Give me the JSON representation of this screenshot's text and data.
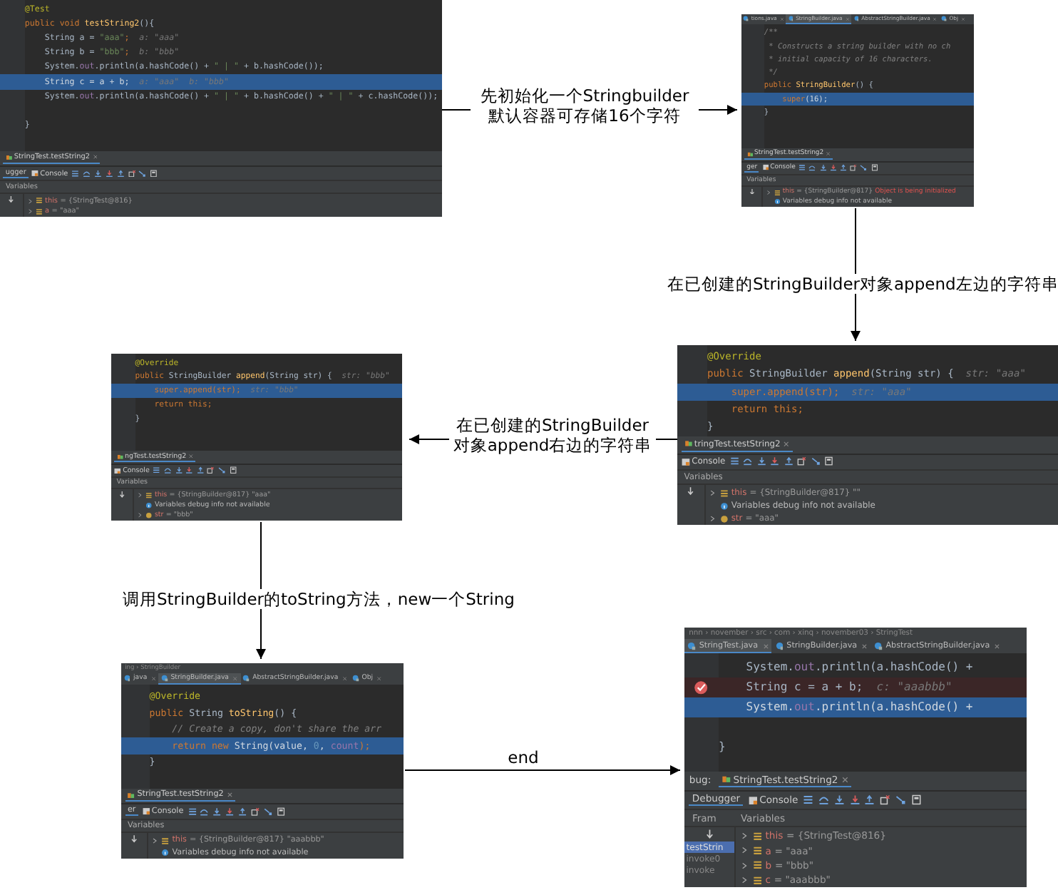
{
  "panels": [
    {
      "code": [
        {
          "highlight": false,
          "breakpoint": false,
          "segments": [
            {
              "text": "@Test",
              "kind": "ann"
            }
          ]
        },
        {
          "highlight": false,
          "breakpoint": false,
          "segments": [
            {
              "text": "public void ",
              "kind": "kw"
            },
            {
              "text": "testString2",
              "kind": "fn"
            },
            {
              "text": "(){",
              "kind": "plain"
            }
          ]
        },
        {
          "highlight": false,
          "breakpoint": false,
          "segments": [
            {
              "text": "    String a = ",
              "kind": "plain"
            },
            {
              "text": "\"aaa\"",
              "kind": "str"
            },
            {
              "text": ";",
              "kind": "kw"
            },
            {
              "text": "  a: \"aaa\"",
              "kind": "hint"
            }
          ]
        },
        {
          "highlight": false,
          "breakpoint": false,
          "segments": [
            {
              "text": "    String b = ",
              "kind": "plain"
            },
            {
              "text": "\"bbb\"",
              "kind": "str"
            },
            {
              "text": ";",
              "kind": "kw"
            },
            {
              "text": "  b: \"bbb\"",
              "kind": "hint"
            }
          ]
        },
        {
          "highlight": false,
          "breakpoint": false,
          "segments": [
            {
              "text": "    System.",
              "kind": "plain"
            },
            {
              "text": "out",
              "kind": "field"
            },
            {
              "text": ".println(a.hashCode() + ",
              "kind": "plain"
            },
            {
              "text": "\" | \"",
              "kind": "str"
            },
            {
              "text": " + b.hashCode());",
              "kind": "plain"
            }
          ]
        },
        {
          "highlight": true,
          "breakpoint": false,
          "segments": [
            {
              "text": "    String c = a + b;",
              "kind": "plain"
            },
            {
              "text": "  a: \"aaa\"  b: \"bbb\"",
              "kind": "hint"
            }
          ]
        },
        {
          "highlight": false,
          "breakpoint": false,
          "segments": [
            {
              "text": "    System.",
              "kind": "plain"
            },
            {
              "text": "out",
              "kind": "field"
            },
            {
              "text": ".println(a.hashCode() + ",
              "kind": "plain"
            },
            {
              "text": "\" | \"",
              "kind": "str"
            },
            {
              "text": " + b.hashCode() + ",
              "kind": "plain"
            },
            {
              "text": "\" | \"",
              "kind": "str"
            },
            {
              "text": " + c.hashCode());",
              "kind": "plain"
            }
          ]
        },
        {
          "highlight": false,
          "breakpoint": false
        },
        {
          "highlight": false,
          "breakpoint": false,
          "segments": [
            {
              "text": "}",
              "kind": "plain"
            }
          ]
        }
      ],
      "session": "StringTest.testString2",
      "debugger_label": "ugger",
      "console_label": "Console",
      "variables_label": "Variables",
      "variables": [
        {
          "kind": "field",
          "name": "this",
          "value": "= {StringTest@816}"
        },
        {
          "kind": "field",
          "name": "a",
          "value": "= \"aaa\""
        }
      ]
    },
    {
      "tabs": [
        {
          "label": "tions.java",
          "selected": false
        },
        {
          "label": "StringBuilder.java",
          "selected": true
        },
        {
          "label": "AbstractStringBuilder.java",
          "selected": false
        },
        {
          "label": "Obj",
          "selected": false
        }
      ],
      "code": [
        {
          "highlight": false,
          "breakpoint": false,
          "segments": [
            {
              "text": "/**",
              "kind": "cm"
            }
          ]
        },
        {
          "highlight": false,
          "breakpoint": false,
          "segments": [
            {
              "text": " * Constructs a string builder with no ch",
              "kind": "cm"
            }
          ]
        },
        {
          "highlight": false,
          "breakpoint": false,
          "segments": [
            {
              "text": " * initial capacity of 16 characters.",
              "kind": "cm"
            }
          ]
        },
        {
          "highlight": false,
          "breakpoint": false,
          "segments": [
            {
              "text": " */",
              "kind": "cm"
            }
          ]
        },
        {
          "highlight": false,
          "breakpoint": false,
          "segments": [
            {
              "text": "public ",
              "kind": "kw"
            },
            {
              "text": "StringBuilder",
              "kind": "fn"
            },
            {
              "text": "() {",
              "kind": "plain"
            }
          ]
        },
        {
          "highlight": true,
          "breakpoint": false,
          "segments": [
            {
              "text": "    super",
              "kind": "kw"
            },
            {
              "text": "(16);",
              "kind": "plain"
            }
          ]
        },
        {
          "highlight": false,
          "breakpoint": false,
          "segments": [
            {
              "text": "}",
              "kind": "plain"
            }
          ]
        }
      ],
      "session": "StringTest.testString2",
      "debugger_label": "ger",
      "console_label": "Console",
      "variables_label": "Variables",
      "variables": [
        {
          "kind": "field",
          "name": "this",
          "value": "= {StringBuilder@817}",
          "note": "Object is being initialized"
        },
        {
          "kind": "info",
          "value": "Variables debug info not available"
        }
      ]
    },
    {
      "code": [
        {
          "highlight": false,
          "breakpoint": false,
          "segments": [
            {
              "text": "@Override",
              "kind": "ann"
            }
          ]
        },
        {
          "highlight": false,
          "breakpoint": false,
          "segments": [
            {
              "text": "public ",
              "kind": "kw"
            },
            {
              "text": "StringBuilder ",
              "kind": "plain"
            },
            {
              "text": "append",
              "kind": "fn"
            },
            {
              "text": "(String str) {",
              "kind": "plain"
            },
            {
              "text": "  str: \"bbb\"",
              "kind": "hint"
            }
          ]
        },
        {
          "highlight": true,
          "breakpoint": false,
          "segments": [
            {
              "text": "    super",
              "kind": "kw"
            },
            {
              "text": ".append(str);",
              "kind": "kw"
            },
            {
              "text": "  str: \"bbb\"",
              "kind": "hint"
            }
          ]
        },
        {
          "highlight": false,
          "breakpoint": false,
          "segments": [
            {
              "text": "    return this;",
              "kind": "kw"
            }
          ]
        },
        {
          "highlight": false,
          "breakpoint": false,
          "segments": [
            {
              "text": "}",
              "kind": "plain"
            }
          ]
        }
      ],
      "session": "ngTest.testString2",
      "console_label": "Console",
      "variables_label": "Variables",
      "variables": [
        {
          "kind": "field",
          "name": "this",
          "value": "= {StringBuilder@817} \"aaa\""
        },
        {
          "kind": "info",
          "value": "Variables debug info not available"
        },
        {
          "kind": "param",
          "name": "str",
          "value": "= \"bbb\""
        }
      ]
    },
    {
      "code": [
        {
          "highlight": false,
          "breakpoint": false,
          "segments": [
            {
              "text": "@Override",
              "kind": "ann"
            }
          ]
        },
        {
          "highlight": false,
          "breakpoint": false,
          "segments": [
            {
              "text": "public ",
              "kind": "kw"
            },
            {
              "text": "StringBuilder ",
              "kind": "plain"
            },
            {
              "text": "append",
              "kind": "fn"
            },
            {
              "text": "(String str) {",
              "kind": "plain"
            },
            {
              "text": "  str: \"aaa\"",
              "kind": "hint"
            }
          ]
        },
        {
          "highlight": true,
          "breakpoint": false,
          "segments": [
            {
              "text": "    super",
              "kind": "kw"
            },
            {
              "text": ".append(str);",
              "kind": "kw"
            },
            {
              "text": "  str: \"aaa\"",
              "kind": "hint"
            }
          ]
        },
        {
          "highlight": false,
          "breakpoint": false,
          "segments": [
            {
              "text": "    return this;",
              "kind": "kw"
            }
          ]
        },
        {
          "highlight": false,
          "breakpoint": false,
          "segments": [
            {
              "text": "}",
              "kind": "plain"
            }
          ]
        }
      ],
      "session": "tringTest.testString2",
      "console_label": "Console",
      "variables_label": "Variables",
      "variables": [
        {
          "kind": "field",
          "name": "this",
          "value": "= {StringBuilder@817} \"\""
        },
        {
          "kind": "info",
          "value": "Variables debug info not available"
        },
        {
          "kind": "param",
          "name": "str",
          "value": "= \"aaa\""
        }
      ]
    },
    {
      "tabs": [
        {
          "label": "java",
          "selected": false
        },
        {
          "label": "StringBuilder.java",
          "selected": true
        },
        {
          "label": "AbstractStringBuilder.java",
          "selected": false
        },
        {
          "label": "Obj",
          "selected": false
        }
      ],
      "breadcrumb": "ing › StringBuilder",
      "code": [
        {
          "highlight": false,
          "breakpoint": false,
          "segments": [
            {
              "text": "@Override",
              "kind": "ann"
            }
          ]
        },
        {
          "highlight": false,
          "breakpoint": false,
          "segments": [
            {
              "text": "public ",
              "kind": "kw"
            },
            {
              "text": "String ",
              "kind": "plain"
            },
            {
              "text": "toString",
              "kind": "fn"
            },
            {
              "text": "() {",
              "kind": "plain"
            }
          ]
        },
        {
          "highlight": false,
          "breakpoint": false,
          "segments": [
            {
              "text": "    // Create a copy, don't share the arr",
              "kind": "cm"
            }
          ]
        },
        {
          "highlight": true,
          "breakpoint": false,
          "segments": [
            {
              "text": "    return new ",
              "kind": "kw"
            },
            {
              "text": "String(value, ",
              "kind": "plain"
            },
            {
              "text": "0",
              "kind": "num"
            },
            {
              "text": ", ",
              "kind": "plain"
            },
            {
              "text": "count",
              "kind": "field"
            },
            {
              "text": ");",
              "kind": "kw"
            }
          ]
        },
        {
          "highlight": false,
          "breakpoint": false,
          "segments": [
            {
              "text": "}",
              "kind": "plain"
            }
          ]
        }
      ],
      "session": "StringTest.testString2",
      "debugger_label": "er",
      "console_label": "Console",
      "variables_label": "Variables",
      "variables": [
        {
          "kind": "field",
          "name": "this",
          "value": "= {StringBuilder@817} \"aaabbb\""
        },
        {
          "kind": "info",
          "value": "Variables debug info not available"
        }
      ]
    },
    {
      "tabs": [
        {
          "label": "StringTest.java",
          "selected": true
        },
        {
          "label": "StringBuilder.java",
          "selected": false
        },
        {
          "label": "AbstractStringBuilder.java",
          "selected": false
        }
      ],
      "breadcrumb": "nnn › november › src › com › xinq › november03 › StringTest",
      "code": [
        {
          "highlight": false,
          "breakpoint": false,
          "segments": [
            {
              "text": "    System.",
              "kind": "plain"
            },
            {
              "text": "out",
              "kind": "field"
            },
            {
              "text": ".println(a.hashCode() +",
              "kind": "plain"
            }
          ]
        },
        {
          "highlight": false,
          "breakpoint": true,
          "segments": [
            {
              "text": "    String c = a + b;",
              "kind": "plain"
            },
            {
              "text": "  c: \"aaabbb\"",
              "kind": "hint"
            }
          ]
        },
        {
          "highlight": true,
          "breakpoint": false,
          "segments": [
            {
              "text": "    System.",
              "kind": "plain"
            },
            {
              "text": "out",
              "kind": "field"
            },
            {
              "text": ".println(a.hashCode() +",
              "kind": "plain"
            }
          ]
        },
        {
          "highlight": false,
          "breakpoint": false
        },
        {
          "highlight": false,
          "breakpoint": false,
          "segments": [
            {
              "text": "}",
              "kind": "plain"
            }
          ]
        }
      ],
      "session": "StringTest.testString2",
      "debugger_label": "Debugger",
      "console_label": "Console",
      "frames_label": "Fram",
      "variables_label": "Variables",
      "debug_prefix": "bug:",
      "frames": [
        {
          "label": "testStrin",
          "selected": true
        },
        {
          "label": "invoke0",
          "selected": false
        },
        {
          "label": "invoke",
          "selected": false
        }
      ],
      "variables": [
        {
          "kind": "field",
          "name": "this",
          "value": "= {StringTest@816}"
        },
        {
          "kind": "field",
          "name": "a",
          "value": "= \"aaa\""
        },
        {
          "kind": "field",
          "name": "b",
          "value": "= \"bbb\""
        },
        {
          "kind": "field",
          "name": "c",
          "value": "= \"aaabbb\""
        }
      ]
    }
  ],
  "arrows": [
    {
      "label": "先初始化一个Stringbuilder\n默认容器可存储16个字符"
    },
    {
      "label": "在已创建的StringBuilder对象append左边的字符串"
    },
    {
      "label": "在已创建的StringBuilder\n对象append右边的字符串"
    },
    {
      "label": "调用StringBuilder的toString方法，new一个String"
    },
    {
      "label": "end"
    }
  ]
}
